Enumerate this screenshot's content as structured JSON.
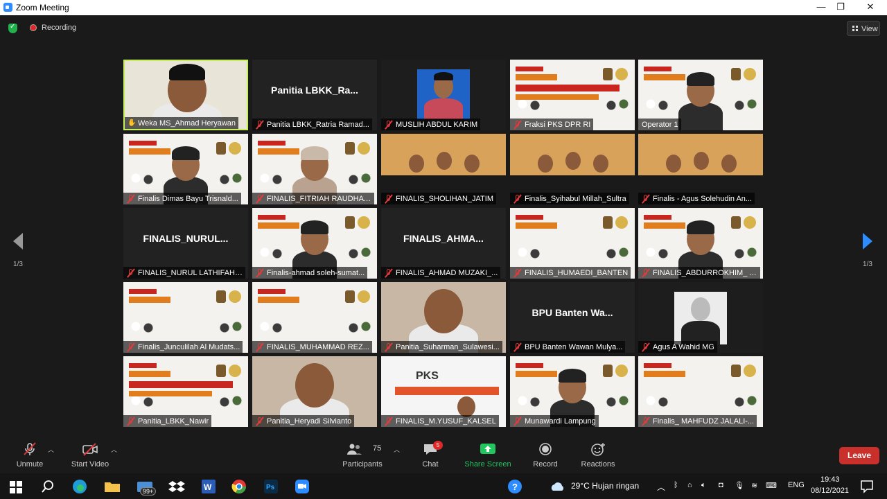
{
  "window": {
    "title": "Zoom Meeting",
    "controls": [
      "—",
      "❐",
      "✕"
    ]
  },
  "meeting": {
    "recording_label": "Recording",
    "view_label": "View",
    "page_indicator_left": "1/3",
    "page_indicator_right": "1/3"
  },
  "tiles": [
    {
      "label": "Weka MS_Ahmad Heryawan",
      "name_only": "",
      "active": true,
      "mic": "hand"
    },
    {
      "label": "Panitia LBKK_Ratria Ramad...",
      "name_only": "Panitia  LBKK_Ra...",
      "active": false,
      "mic": "off"
    },
    {
      "label": "MUSLIH ABDUL KARIM",
      "name_only": "",
      "active": false,
      "mic": "off"
    },
    {
      "label": "Fraksi PKS DPR RI",
      "name_only": "",
      "active": false,
      "mic": "off"
    },
    {
      "label": "Operator 1",
      "name_only": "",
      "active": false,
      "mic": "none"
    },
    {
      "label": "Finalis Dimas Bayu Trisnald...",
      "name_only": "",
      "active": false,
      "mic": "off"
    },
    {
      "label": "FINALIS_FITRIAH RAUDHAT...",
      "name_only": "",
      "active": false,
      "mic": "off"
    },
    {
      "label": "FINALIS_SHOLIHAN_JATIM",
      "name_only": "",
      "active": false,
      "mic": "off"
    },
    {
      "label": "Finalis_Syihabul Millah_Sultra",
      "name_only": "",
      "active": false,
      "mic": "off"
    },
    {
      "label": "Finalis - Agus Solehudin An...",
      "name_only": "",
      "active": false,
      "mic": "off"
    },
    {
      "label": "FINALIS_NURUL LATHIFAH_...",
      "name_only": "FINALIS_NURUL...",
      "active": false,
      "mic": "off"
    },
    {
      "label": "Finalis-ahmad soleh-sumat...",
      "name_only": "",
      "active": false,
      "mic": "off"
    },
    {
      "label": "FINALIS_AHMAD MUZAKI_...",
      "name_only": "FINALIS_AHMA...",
      "active": false,
      "mic": "off"
    },
    {
      "label": "FINALIS_HUMAEDI_BANTEN",
      "name_only": "",
      "active": false,
      "mic": "off"
    },
    {
      "label": "FINALIS_ABDURROKHIM_ A...",
      "name_only": "",
      "active": false,
      "mic": "off"
    },
    {
      "label": "Finalis_Junculilah Al Mudats...",
      "name_only": "",
      "active": false,
      "mic": "off"
    },
    {
      "label": "FINALIS_MUHAMMAD REZ...",
      "name_only": "",
      "active": false,
      "mic": "off"
    },
    {
      "label": "Panitia_Suharman_Sulawesi...",
      "name_only": "",
      "active": false,
      "mic": "off"
    },
    {
      "label": "BPU Banten Wawan Mulya...",
      "name_only": "BPU  Banten  Wa...",
      "active": false,
      "mic": "off"
    },
    {
      "label": "Agus A Wahid MG",
      "name_only": "",
      "active": false,
      "mic": "off"
    },
    {
      "label": "Panitia_LBKK_Nawir",
      "name_only": "",
      "active": false,
      "mic": "off"
    },
    {
      "label": "Panitia_Heryadi Silvianto",
      "name_only": "",
      "active": false,
      "mic": "off"
    },
    {
      "label": "FINALIS_M.YUSUF_KALSEL",
      "name_only": "",
      "active": false,
      "mic": "off"
    },
    {
      "label": "Munawardi Lampung",
      "name_only": "",
      "active": false,
      "mic": "off"
    },
    {
      "label": "Finalis_ MAHFUDZ JALALI-...",
      "name_only": "",
      "active": false,
      "mic": "off"
    }
  ],
  "toolbar": {
    "unmute": "Unmute",
    "start_video": "Start Video",
    "participants": "Participants",
    "participants_count": "75",
    "chat": "Chat",
    "chat_badge": "5",
    "share_screen": "Share Screen",
    "record": "Record",
    "reactions": "Reactions",
    "leave": "Leave"
  },
  "taskbar": {
    "mail_badge": "99+",
    "weather": "29°C  Hujan ringan",
    "language": "ENG",
    "time": "19:43",
    "date": "08/12/2021"
  },
  "colors": {
    "accent": "#2d8cff",
    "active_speaker": "#c6f05a",
    "leave": "#c9302c",
    "share": "#22c55e",
    "mic_off": "#e23b3b"
  }
}
